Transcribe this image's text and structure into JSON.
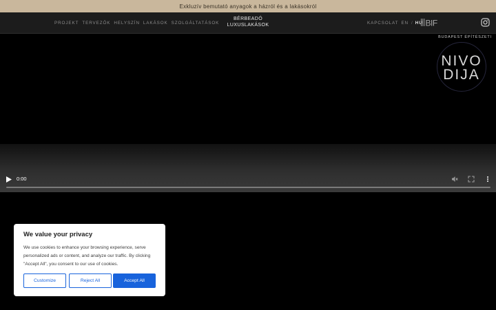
{
  "banner": {
    "text": "Exkluzív bemutató anyagok a házról és a lakásokról"
  },
  "nav": {
    "left_links": [
      "PROJEKT",
      "TERVEZŐK",
      "HELYSZÍN",
      "LAKÁSOK",
      "SZOLGÁLTATÁSOK"
    ],
    "brand_line1": "BÉRBEADÓ",
    "brand_line2": "LUXUSLAKÁSOK",
    "contact": "KAPCSOLAT",
    "lang_en": "EN",
    "lang_sep": "/",
    "lang_hu": "HU",
    "logo_text": "BIF"
  },
  "award": {
    "top_text": "BUDAPEST ÉPÍTÉSZETI",
    "line1": "NIVO",
    "line2": "DIJA"
  },
  "video": {
    "time": "0:00",
    "progress": 0
  },
  "cookie": {
    "title": "We value your privacy",
    "text": "We use cookies to enhance your browsing experience, serve personalized ads or content, and analyze our traffic. By clicking \"Accept All\", you consent to our use of cookies.",
    "customize": "Customize",
    "reject": "Reject All",
    "accept": "Accept All"
  },
  "colors": {
    "banner_bg": "#c9b79c",
    "nav_bg": "#1c1c1c",
    "cookie_accent": "#1863dc"
  }
}
